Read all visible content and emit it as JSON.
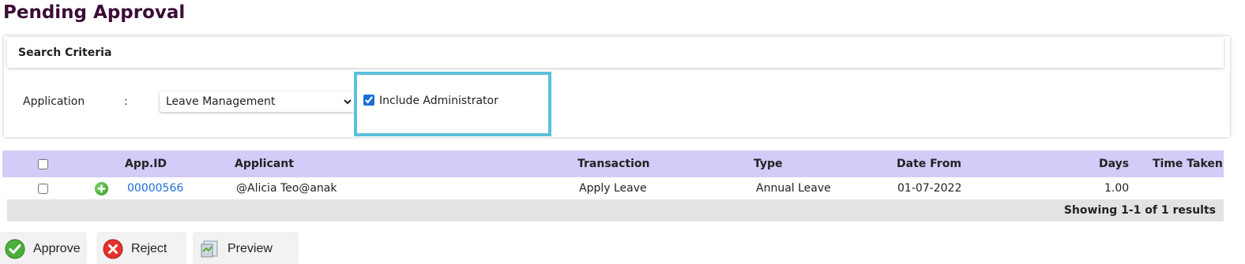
{
  "page": {
    "title": "Pending Approval"
  },
  "search": {
    "header": "Search Criteria",
    "application_label": "Application",
    "colon": ":",
    "application_value": "Leave Management",
    "application_options": [
      "Leave Management"
    ],
    "include_admin_label": "Include Administrator",
    "include_admin_checked": true,
    "highlight_color": "#5bc0d9"
  },
  "grid": {
    "header_color": "#d3cbf8",
    "columns": [
      "App.ID",
      "Applicant",
      "Transaction",
      "Type",
      "Date From",
      "Days",
      "Time Taken"
    ],
    "rows": [
      {
        "app_id": "00000566",
        "applicant": "@Alicia Teo@anak",
        "transaction": "Apply Leave",
        "type": "Annual Leave",
        "date_from": "01-07-2022",
        "days": "1.00",
        "time_taken": "",
        "expand_icon": "plus-circle-icon"
      }
    ],
    "footer": "Showing 1-1 of 1 results"
  },
  "actions": {
    "approve": {
      "label": "Approve",
      "icon": "check-circle-icon"
    },
    "reject": {
      "label": "Reject",
      "icon": "x-circle-icon"
    },
    "preview": {
      "label": "Preview",
      "icon": "preview-icon"
    }
  }
}
